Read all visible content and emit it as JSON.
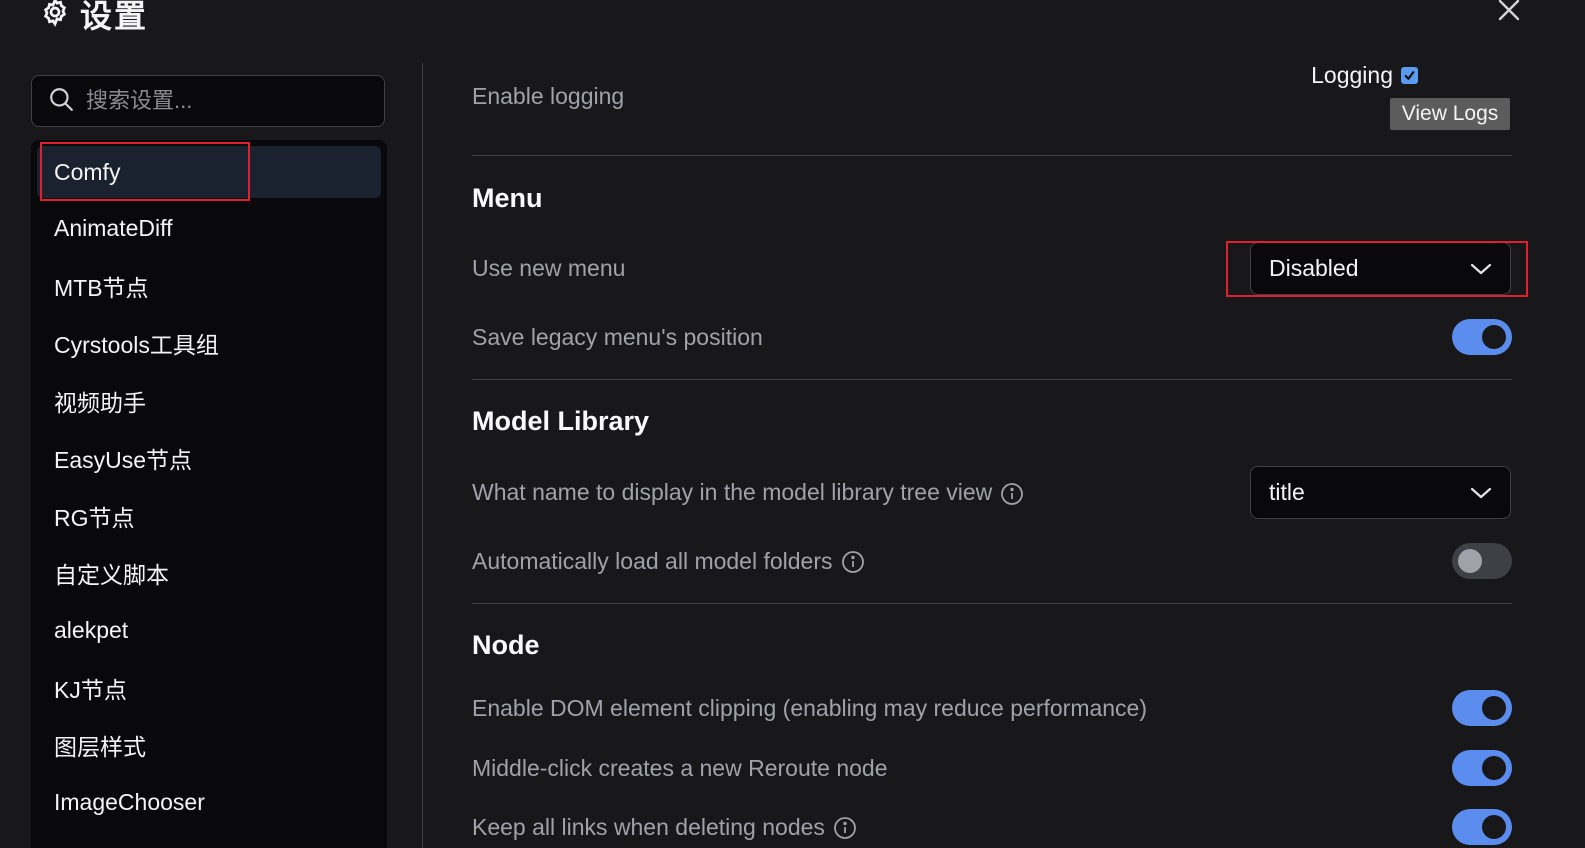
{
  "header": {
    "title": "设置",
    "icon": "gear-icon",
    "close_icon": "close-icon"
  },
  "search": {
    "placeholder": "搜索设置...",
    "value": "",
    "icon": "search-icon"
  },
  "sidebar": {
    "items": [
      {
        "label": "Comfy",
        "selected": true
      },
      {
        "label": "AnimateDiff",
        "selected": false
      },
      {
        "label": "MTB节点",
        "selected": false
      },
      {
        "label": "Cyrstools工具组",
        "selected": false
      },
      {
        "label": "视频助手",
        "selected": false
      },
      {
        "label": "EasyUse节点",
        "selected": false
      },
      {
        "label": "RG节点",
        "selected": false
      },
      {
        "label": "自定义脚本",
        "selected": false
      },
      {
        "label": "alekpet",
        "selected": false
      },
      {
        "label": "KJ节点",
        "selected": false
      },
      {
        "label": "图层样式",
        "selected": false
      },
      {
        "label": "ImageChooser",
        "selected": false
      }
    ]
  },
  "main": {
    "logging": {
      "label": "Enable logging",
      "checkbox_label": "Logging",
      "checked": true,
      "view_logs_label": "View Logs"
    },
    "sections": {
      "menu": {
        "title": "Menu",
        "use_new_menu": {
          "label": "Use new menu",
          "value": "Disabled"
        },
        "save_legacy": {
          "label": "Save legacy menu's position",
          "enabled": true
        }
      },
      "model_library": {
        "title": "Model Library",
        "display_name": {
          "label": "What name to display in the model library tree view",
          "value": "title"
        },
        "auto_load": {
          "label": "Automatically load all model folders",
          "enabled": false
        }
      },
      "node": {
        "title": "Node",
        "dom_clipping": {
          "label": "Enable DOM element clipping (enabling may reduce performance)",
          "enabled": true
        },
        "middle_click": {
          "label": "Middle-click creates a new Reroute node",
          "enabled": true
        },
        "keep_links": {
          "label": "Keep all links when deleting nodes",
          "enabled": true
        }
      }
    }
  },
  "colors": {
    "background": "#18181b",
    "sidebar_bg": "#09090b",
    "toggle_on": "#5b8def",
    "toggle_off": "#3f3f46",
    "highlight": "#e0202e"
  }
}
